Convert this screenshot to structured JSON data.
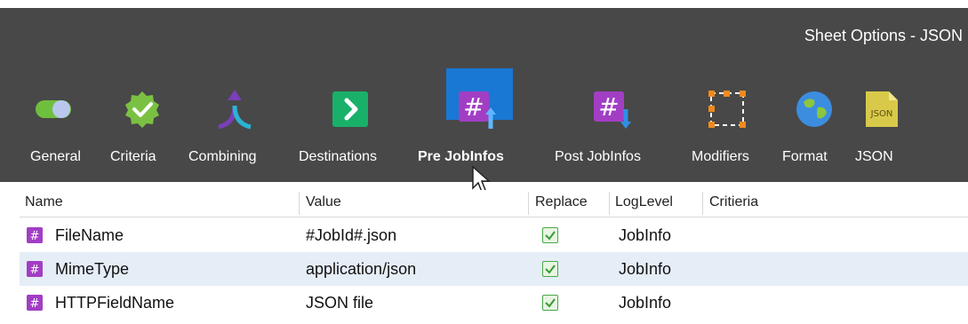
{
  "window": {
    "title": "Sheet Options - JSON"
  },
  "toolbar": {
    "items": [
      {
        "label": "General",
        "icon": "toggle-icon"
      },
      {
        "label": "Criteria",
        "icon": "badge-check-icon"
      },
      {
        "label": "Combining",
        "icon": "merge-arrow-icon"
      },
      {
        "label": "Destinations",
        "icon": "arrow-right-box-icon"
      },
      {
        "label": "Pre JobInfos",
        "icon": "hash-up-icon",
        "active": true
      },
      {
        "label": "Post JobInfos",
        "icon": "hash-down-icon"
      },
      {
        "label": "Modifiers",
        "icon": "dashed-frame-icon"
      },
      {
        "label": "Format",
        "icon": "globe-icon"
      },
      {
        "label": "JSON",
        "icon": "json-file-icon"
      }
    ]
  },
  "table": {
    "columns": [
      "Name",
      "Value",
      "Replace",
      "LogLevel",
      "Critieria"
    ],
    "rows": [
      {
        "name": "FileName",
        "value": "#JobId#.json",
        "replace": true,
        "loglevel": "JobInfo",
        "criteria": ""
      },
      {
        "name": "MimeType",
        "value": "application/json",
        "replace": true,
        "loglevel": "JobInfo",
        "criteria": "",
        "selected": true
      },
      {
        "name": "HTTPFieldName",
        "value": "JSON file",
        "replace": true,
        "loglevel": "JobInfo",
        "criteria": ""
      }
    ]
  },
  "colors": {
    "toolbar_bg": "#484848",
    "active_bg": "#1978d4",
    "hash_purple": "#a23ec4",
    "check_green": "#4aa84a",
    "selected_row": "#e5edf7"
  }
}
